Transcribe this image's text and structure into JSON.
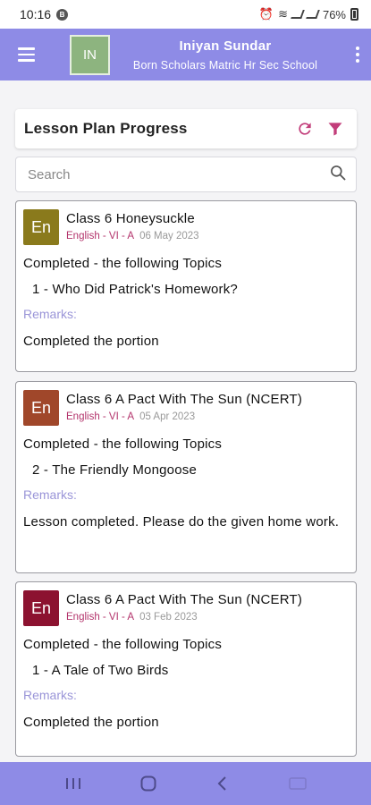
{
  "status": {
    "time": "10:16",
    "notif_badge": "B",
    "battery": "76%"
  },
  "app_bar": {
    "avatar_initials": "IN",
    "user_name": "Iniyan Sundar",
    "school": "Born Scholars Matric Hr Sec School"
  },
  "header": {
    "title": "Lesson Plan Progress",
    "refresh_icon": "refresh-icon",
    "filter_icon": "filter-icon"
  },
  "search": {
    "placeholder": "Search",
    "value": ""
  },
  "cards": [
    {
      "subject_abbr": "En",
      "badge_color": "#8a7a1c",
      "title": "Class 6 Honeysuckle",
      "class": "English - VI - A",
      "date": "06 May 2023",
      "status_text": "Completed - the following Topics",
      "topic": "1 - Who Did Patrick's Homework?",
      "remarks_label": "Remarks:",
      "remarks": "Completed the portion"
    },
    {
      "subject_abbr": "En",
      "badge_color": "#a0472a",
      "title": "Class 6 A Pact With The Sun (NCERT)",
      "class": "English - VI - A",
      "date": "05 Apr 2023",
      "status_text": "Completed - the following Topics",
      "topic": "2 - The Friendly Mongoose",
      "remarks_label": "Remarks:",
      "remarks": "Lesson completed. Please do the given home work."
    },
    {
      "subject_abbr": "En",
      "badge_color": "#8c1230",
      "title": "Class 6 A Pact With The Sun (NCERT)",
      "class": "English - VI - A",
      "date": "03 Feb 2023",
      "status_text": "Completed - the following Topics",
      "topic": "1 - A Tale of Two Birds",
      "remarks_label": "Remarks:",
      "remarks": "Completed the portion"
    }
  ],
  "colors": {
    "primary": "#8e8be6",
    "accent": "#b3336b",
    "remarks": "#9a95d8"
  }
}
